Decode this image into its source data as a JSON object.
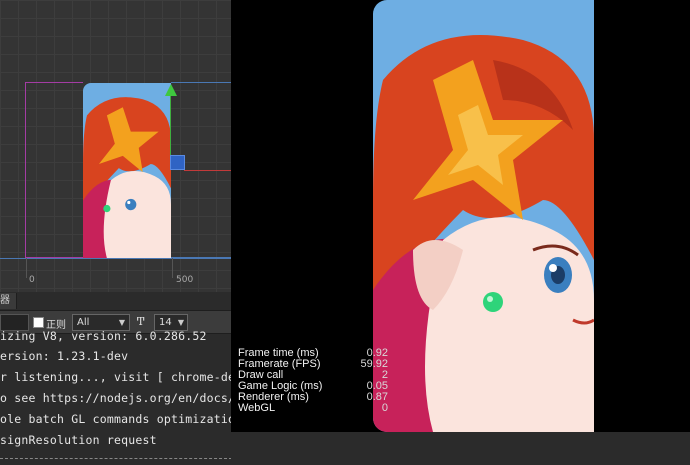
{
  "scene": {
    "ticks": [
      "0",
      "500"
    ]
  },
  "console": {
    "tab_label": "器",
    "filter_value": "",
    "regex_label": "正则",
    "level_selected": "All",
    "font_icon_glyph": "T̲T",
    "font_size_selected": "14",
    "lines": [
      "izing V8, version: 6.0.286.52",
      "ersion: 1.23.1-dev",
      "r listening..., visit [ chrome-devtools",
      "o see https://nodejs.org/en/docs/inspe",
      "ole batch GL commands optimization!",
      "signResolution request"
    ]
  },
  "stats": [
    {
      "label": "Frame time (ms)",
      "value": "0.92"
    },
    {
      "label": "Framerate (FPS)",
      "value": "59.92"
    },
    {
      "label": "Draw call",
      "value": "2"
    },
    {
      "label": "Game Logic (ms)",
      "value": "0.05"
    },
    {
      "label": "Renderer (ms)",
      "value": "0.87"
    },
    {
      "label": "WebGL",
      "value": "0"
    }
  ],
  "colors": {
    "sky": "#6eaee3",
    "hair": "#d8441f",
    "star": "#f3a11e",
    "skin": "#fbe4dd",
    "magenta": "#c7225a"
  }
}
